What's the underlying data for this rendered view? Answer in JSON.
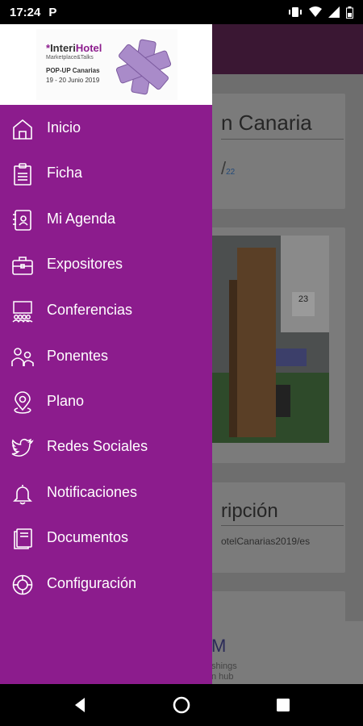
{
  "status_bar": {
    "time": "17:24",
    "notification": "P"
  },
  "drawer": {
    "banner": {
      "title_star": "*",
      "title_a": "Interi",
      "title_b": "Hotel",
      "subtitle": "Marketplace&Talks",
      "event": "POP-UP Canarias",
      "dates": "19 - 20 Junio 2019"
    },
    "menu": [
      {
        "label": "Inicio",
        "icon": "home-icon"
      },
      {
        "label": "Ficha",
        "icon": "clipboard-icon"
      },
      {
        "label": "Mi Agenda",
        "icon": "agenda-icon"
      },
      {
        "label": "Expositores",
        "icon": "briefcase-icon"
      },
      {
        "label": "Conferencias",
        "icon": "conference-icon"
      },
      {
        "label": "Ponentes",
        "icon": "speakers-icon"
      },
      {
        "label": "Plano",
        "icon": "map-pin-icon"
      },
      {
        "label": "Redes Sociales",
        "icon": "twitter-icon"
      },
      {
        "label": "Notificaciones",
        "icon": "bell-icon"
      },
      {
        "label": "Documentos",
        "icon": "document-icon"
      },
      {
        "label": "Configuración",
        "icon": "settings-icon"
      }
    ]
  },
  "background": {
    "card1_title": "n Canaria",
    "card1_date": "/",
    "card1_date_small": "22",
    "photo_sign": "23",
    "card3_title": "ripción",
    "card3_url": "otelCanarias2019/es",
    "sponsor_logo": "M",
    "sponsor_line1": "shings",
    "sponsor_line2": "n hub"
  },
  "colors": {
    "drawer": "#8c1c8d",
    "header": "#3a1733"
  }
}
